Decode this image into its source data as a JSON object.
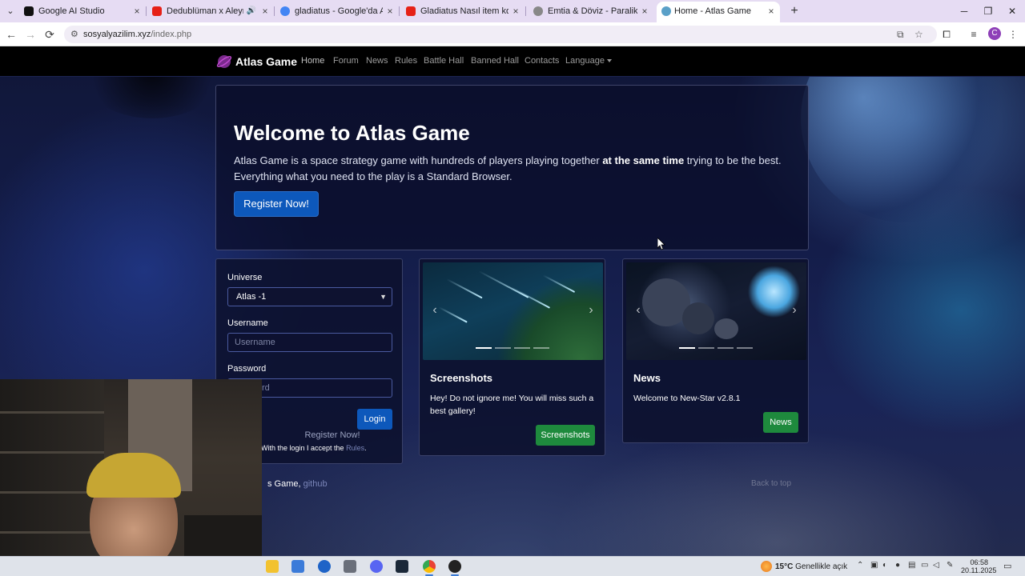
{
  "browser": {
    "tabs": [
      {
        "title": "Google AI Studio",
        "favicon_color": "#111111",
        "active": false
      },
      {
        "title": "Dedublüman x Aleyna Tilki",
        "favicon_color": "#e62117",
        "active": false
      },
      {
        "title": "gladiatus - Google'da Ara",
        "favicon_color": "#4285f4",
        "active": false
      },
      {
        "title": "Gladiatus Nasıl item kombini yap",
        "favicon_color": "#e62117",
        "active": false
      },
      {
        "title": "Emtia & Döviz - Paralika",
        "favicon_color": "#888888",
        "active": false
      },
      {
        "title": "Home - Atlas Game",
        "favicon_color": "#5aa0c8",
        "active": true
      }
    ],
    "tab_menu_icon": "chevron-down-icon",
    "close_glyph": "×",
    "new_tab_glyph": "+",
    "window_buttons": [
      "─",
      "❐",
      "✕"
    ],
    "back_glyph": "←",
    "forward_glyph": "→",
    "reload_glyph": "⟳",
    "url_domain": "sosyalyazilim.xyz",
    "url_path": "/index.php",
    "profile_initial": "C"
  },
  "navbar": {
    "brand": "Atlas Game",
    "links": [
      "Home",
      "Forum",
      "News",
      "Rules",
      "Battle Hall",
      "Banned Hall",
      "Contacts"
    ],
    "language": "Language"
  },
  "jumbotron": {
    "title": "Welcome to Atlas Game",
    "lead_part1": "Atlas Game is a space strategy game with hundreds of players playing together ",
    "lead_bold": "at the same time",
    "lead_part2": " trying to be the best. Everything what you need to the play is a Standard Browser.",
    "register_button": "Register Now!"
  },
  "login": {
    "universe_label": "Universe",
    "universe_selected": "Atlas -1",
    "username_label": "Username",
    "username_placeholder": "Username",
    "password_label": "Password",
    "password_placeholder_visible": "rd",
    "login_button": "Login",
    "register_link": "Register Now!",
    "accept_text": "With the login I accept the ",
    "rules_link": "Rules",
    "accept_end": "."
  },
  "screenshots_card": {
    "title": "Screenshots",
    "text": "Hey! Do not ignore me! You will miss such a best gallery!",
    "button": "Screenshots",
    "slides": 4,
    "active_slide": 1
  },
  "news_card": {
    "title": "News",
    "text": "Welcome to New-Star v2.8.1",
    "button": "News",
    "slides": 4,
    "active_slide": 1
  },
  "footer": {
    "left_visible": "s Game, ",
    "github": "github",
    "right": "Back to top"
  },
  "taskbar": {
    "temperature": "15°C",
    "weather_text": "Genellikle açık",
    "time": "06:58",
    "date": "20.11.2025"
  },
  "colors": {
    "primary_button": "#0d58bb",
    "success_button": "#1e8a3d",
    "navbar_bg": "#000000"
  }
}
